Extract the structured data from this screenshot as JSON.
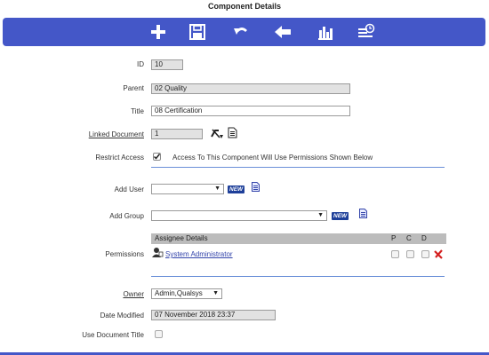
{
  "window": {
    "title": "Component Details"
  },
  "toolbar": {
    "add_icon": "plus-icon",
    "save_icon": "save-icon",
    "undo_icon": "undo-icon",
    "back_icon": "back-arrow-icon",
    "chart_icon": "bar-chart-icon",
    "history_icon": "history-list-icon"
  },
  "form": {
    "id_label": "ID",
    "id_value": "10",
    "parent_label": "Parent",
    "parent_value": "02 Quality",
    "title_label": "Title",
    "title_value": "08 Certification",
    "linked_document_label": "Linked Document",
    "linked_document_value": "1",
    "restrict_access_label": "Restrict Access",
    "restrict_access_checked": true,
    "restrict_access_text": "Access To This Component Will Use Permissions Shown Below",
    "add_user_label": "Add User",
    "add_user_value": "",
    "add_group_label": "Add Group",
    "add_group_value": "",
    "new_badge": "NEW",
    "permissions_label": "Permissions",
    "permissions": {
      "columns": [
        "Assignee Details",
        "P",
        "C",
        "D"
      ],
      "rows": [
        {
          "assignee": "System Administrator",
          "p": false,
          "c": false,
          "d": false
        }
      ]
    },
    "owner_label": "Owner",
    "owner_value": "Admin,Qualsys",
    "date_modified_label": "Date Modified",
    "date_modified_value": "07 November 2018 23:37",
    "use_document_title_label": "Use Document Title",
    "use_document_title_checked": false
  },
  "colors": {
    "toolbar_bg": "#4457c8",
    "divider": "#6a8fd8",
    "new_badge": "#1e3f99",
    "delete_red": "#d42020"
  }
}
